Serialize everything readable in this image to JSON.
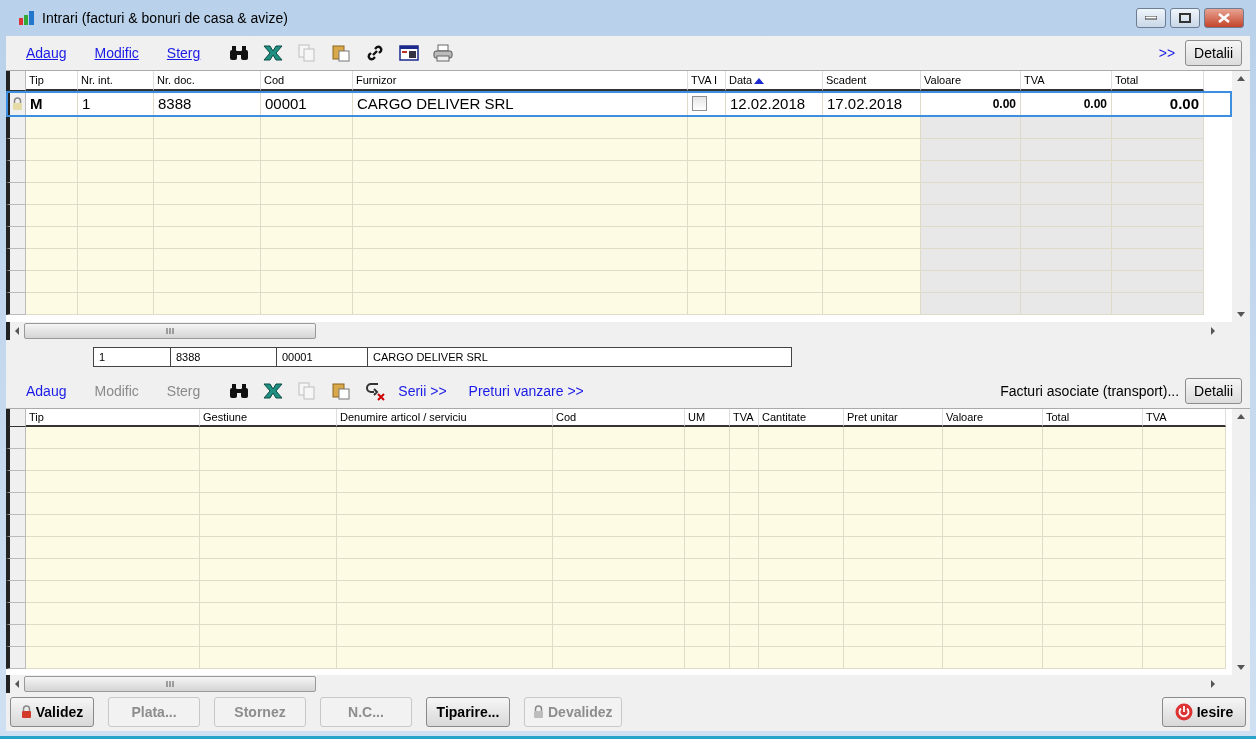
{
  "window": {
    "title": "Intrari (facturi & bonuri de casa & avize)"
  },
  "top_toolbar": {
    "links": [
      {
        "label": "Adaug",
        "disabled": false
      },
      {
        "label": "Modific",
        "disabled": false
      },
      {
        "label": "Sterg",
        "disabled": false
      }
    ],
    "icons": [
      {
        "kind": "binoculars",
        "disabled": false
      },
      {
        "kind": "excel",
        "disabled": false
      },
      {
        "kind": "copy",
        "disabled": true
      },
      {
        "kind": "paste",
        "disabled": false
      },
      {
        "kind": "link",
        "disabled": false
      },
      {
        "kind": "table",
        "disabled": false
      },
      {
        "kind": "printer",
        "disabled": false
      }
    ],
    "more": ">>",
    "details_button": "Detalii"
  },
  "top_table": {
    "columns": [
      {
        "label": "Tip",
        "sorted": false
      },
      {
        "label": "Nr. int.",
        "sorted": false
      },
      {
        "label": "Nr. doc.",
        "sorted": false
      },
      {
        "label": "Cod",
        "sorted": false
      },
      {
        "label": "Furnizor",
        "sorted": false
      },
      {
        "label": "TVA I",
        "sorted": false
      },
      {
        "label": "Data",
        "sorted": true
      },
      {
        "label": "Scadent",
        "sorted": false
      },
      {
        "label": "Valoare",
        "sorted": false
      },
      {
        "label": "TVA",
        "sorted": false
      },
      {
        "label": "Total",
        "sorted": false
      }
    ],
    "rows": [
      {
        "selected": true,
        "locked": true,
        "tip": "M",
        "nr_int": "1",
        "nr_doc": "8388",
        "cod": "00001",
        "furnizor": "CARGO DELIVER SRL",
        "tva_i": false,
        "data": "12.02.2018",
        "scadent": "17.02.2018",
        "valoare": "0.00",
        "tva": "0.00",
        "total": "0.00"
      }
    ]
  },
  "summary": [
    "1",
    "8388",
    "00001",
    "CARGO DELIVER SRL"
  ],
  "bottom_toolbar": {
    "links": [
      {
        "label": "Adaug",
        "disabled": false
      },
      {
        "label": "Modific",
        "disabled": true
      },
      {
        "label": "Sterg",
        "disabled": true
      }
    ],
    "icons": [
      {
        "kind": "binoculars",
        "disabled": false
      },
      {
        "kind": "excel",
        "disabled": false
      },
      {
        "kind": "copy",
        "disabled": true
      },
      {
        "kind": "paste",
        "disabled": false
      },
      {
        "kind": "undo",
        "disabled": false
      }
    ],
    "extra_links": [
      "Serii >>",
      "Preturi vanzare >>"
    ],
    "associated": "Facturi asociate (transport)...",
    "details_button": "Detalii"
  },
  "bottom_table": {
    "columns": [
      "Tip",
      "Gestiune",
      "Denumire articol / serviciu",
      "Cod",
      "UM",
      "TVA",
      "Cantitate",
      "Pret unitar",
      "Valoare",
      "Total",
      "TVA"
    ]
  },
  "buttons": [
    {
      "label": "Validez",
      "disabled": false,
      "kind": "lock"
    },
    {
      "label": "Plata...",
      "disabled": true,
      "kind": "plain"
    },
    {
      "label": "Stornez",
      "disabled": true,
      "kind": "plain"
    },
    {
      "label": "N.C...",
      "disabled": true,
      "kind": "plain"
    },
    {
      "label": "Tiparire...",
      "disabled": false,
      "kind": "plain"
    },
    {
      "label": "Devalidez",
      "disabled": true,
      "kind": "lock"
    }
  ],
  "exit_button": "Iesire"
}
